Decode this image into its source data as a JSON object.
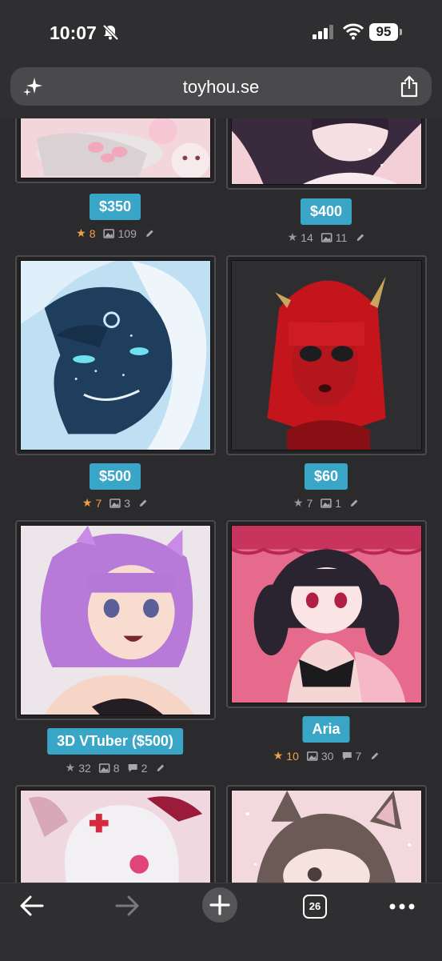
{
  "status": {
    "time": "10:07",
    "battery": "95"
  },
  "browser": {
    "url": "toyhou.se",
    "tab_count": "26"
  },
  "colors": {
    "accent": "#3aa6c7",
    "favorite": "#f0a245",
    "background": "#2b2b2d"
  },
  "characters": [
    {
      "label": "$350",
      "favorites": "8",
      "images": "109",
      "comments": null,
      "favorited": true
    },
    {
      "label": "$400",
      "favorites": "14",
      "images": "11",
      "comments": null,
      "favorited": false
    },
    {
      "label": "$500",
      "favorites": "7",
      "images": "3",
      "comments": null,
      "favorited": true
    },
    {
      "label": "$60",
      "favorites": "7",
      "images": "1",
      "comments": null,
      "favorited": false
    },
    {
      "label": "3D VTuber ($500)",
      "favorites": "32",
      "images": "8",
      "comments": "2",
      "favorited": false
    },
    {
      "label": "Aria",
      "favorites": "10",
      "images": "30",
      "comments": "7",
      "favorited": true
    }
  ],
  "icons": [
    "sparkle-icon",
    "share-icon",
    "star-icon",
    "image-icon",
    "comment-icon",
    "pencil-icon",
    "back-icon",
    "forward-icon",
    "new-tab-icon",
    "tabs-icon",
    "more-icon"
  ]
}
